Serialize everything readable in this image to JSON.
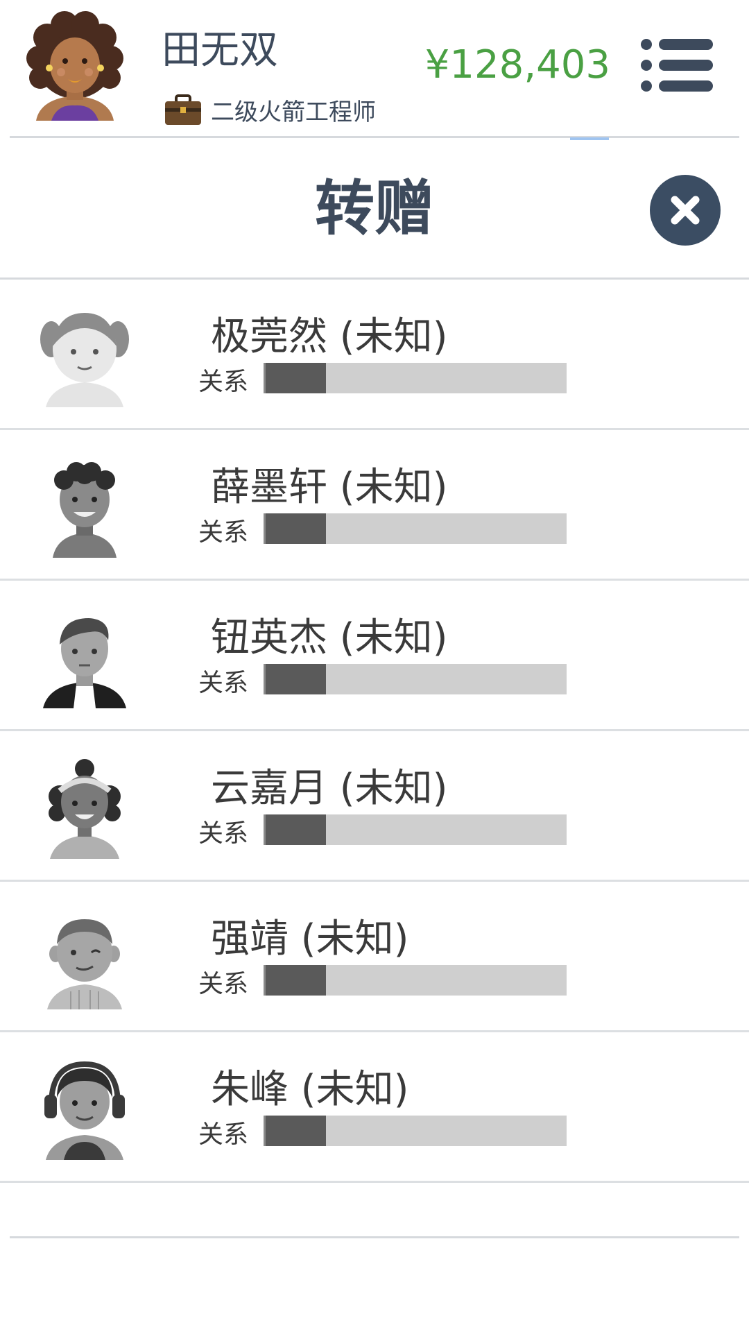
{
  "header": {
    "player_name": "田无双",
    "job_title": "二级火箭工程师",
    "money": "¥128,403"
  },
  "modal": {
    "title": "转赠"
  },
  "contacts": [
    {
      "name": "极莞然 (未知)",
      "relation_label": "关系",
      "relation_level": 0.2
    },
    {
      "name": "薛墨轩 (未知)",
      "relation_label": "关系",
      "relation_level": 0.2
    },
    {
      "name": "钮英杰 (未知)",
      "relation_label": "关系",
      "relation_level": 0.2
    },
    {
      "name": "云嘉月 (未知)",
      "relation_label": "关系",
      "relation_level": 0.2
    },
    {
      "name": "强靖 (未知)",
      "relation_label": "关系",
      "relation_level": 0.2
    },
    {
      "name": "朱峰 (未知)",
      "relation_label": "关系",
      "relation_level": 0.2
    }
  ],
  "colors": {
    "primary": "#3d4a5c",
    "money": "#4aa043",
    "bar_fill": "#5a5a5a",
    "bar_bg": "#cfcfcf"
  },
  "icons": {
    "menu": "list-menu-icon",
    "close": "close-icon",
    "briefcase": "briefcase-icon"
  }
}
